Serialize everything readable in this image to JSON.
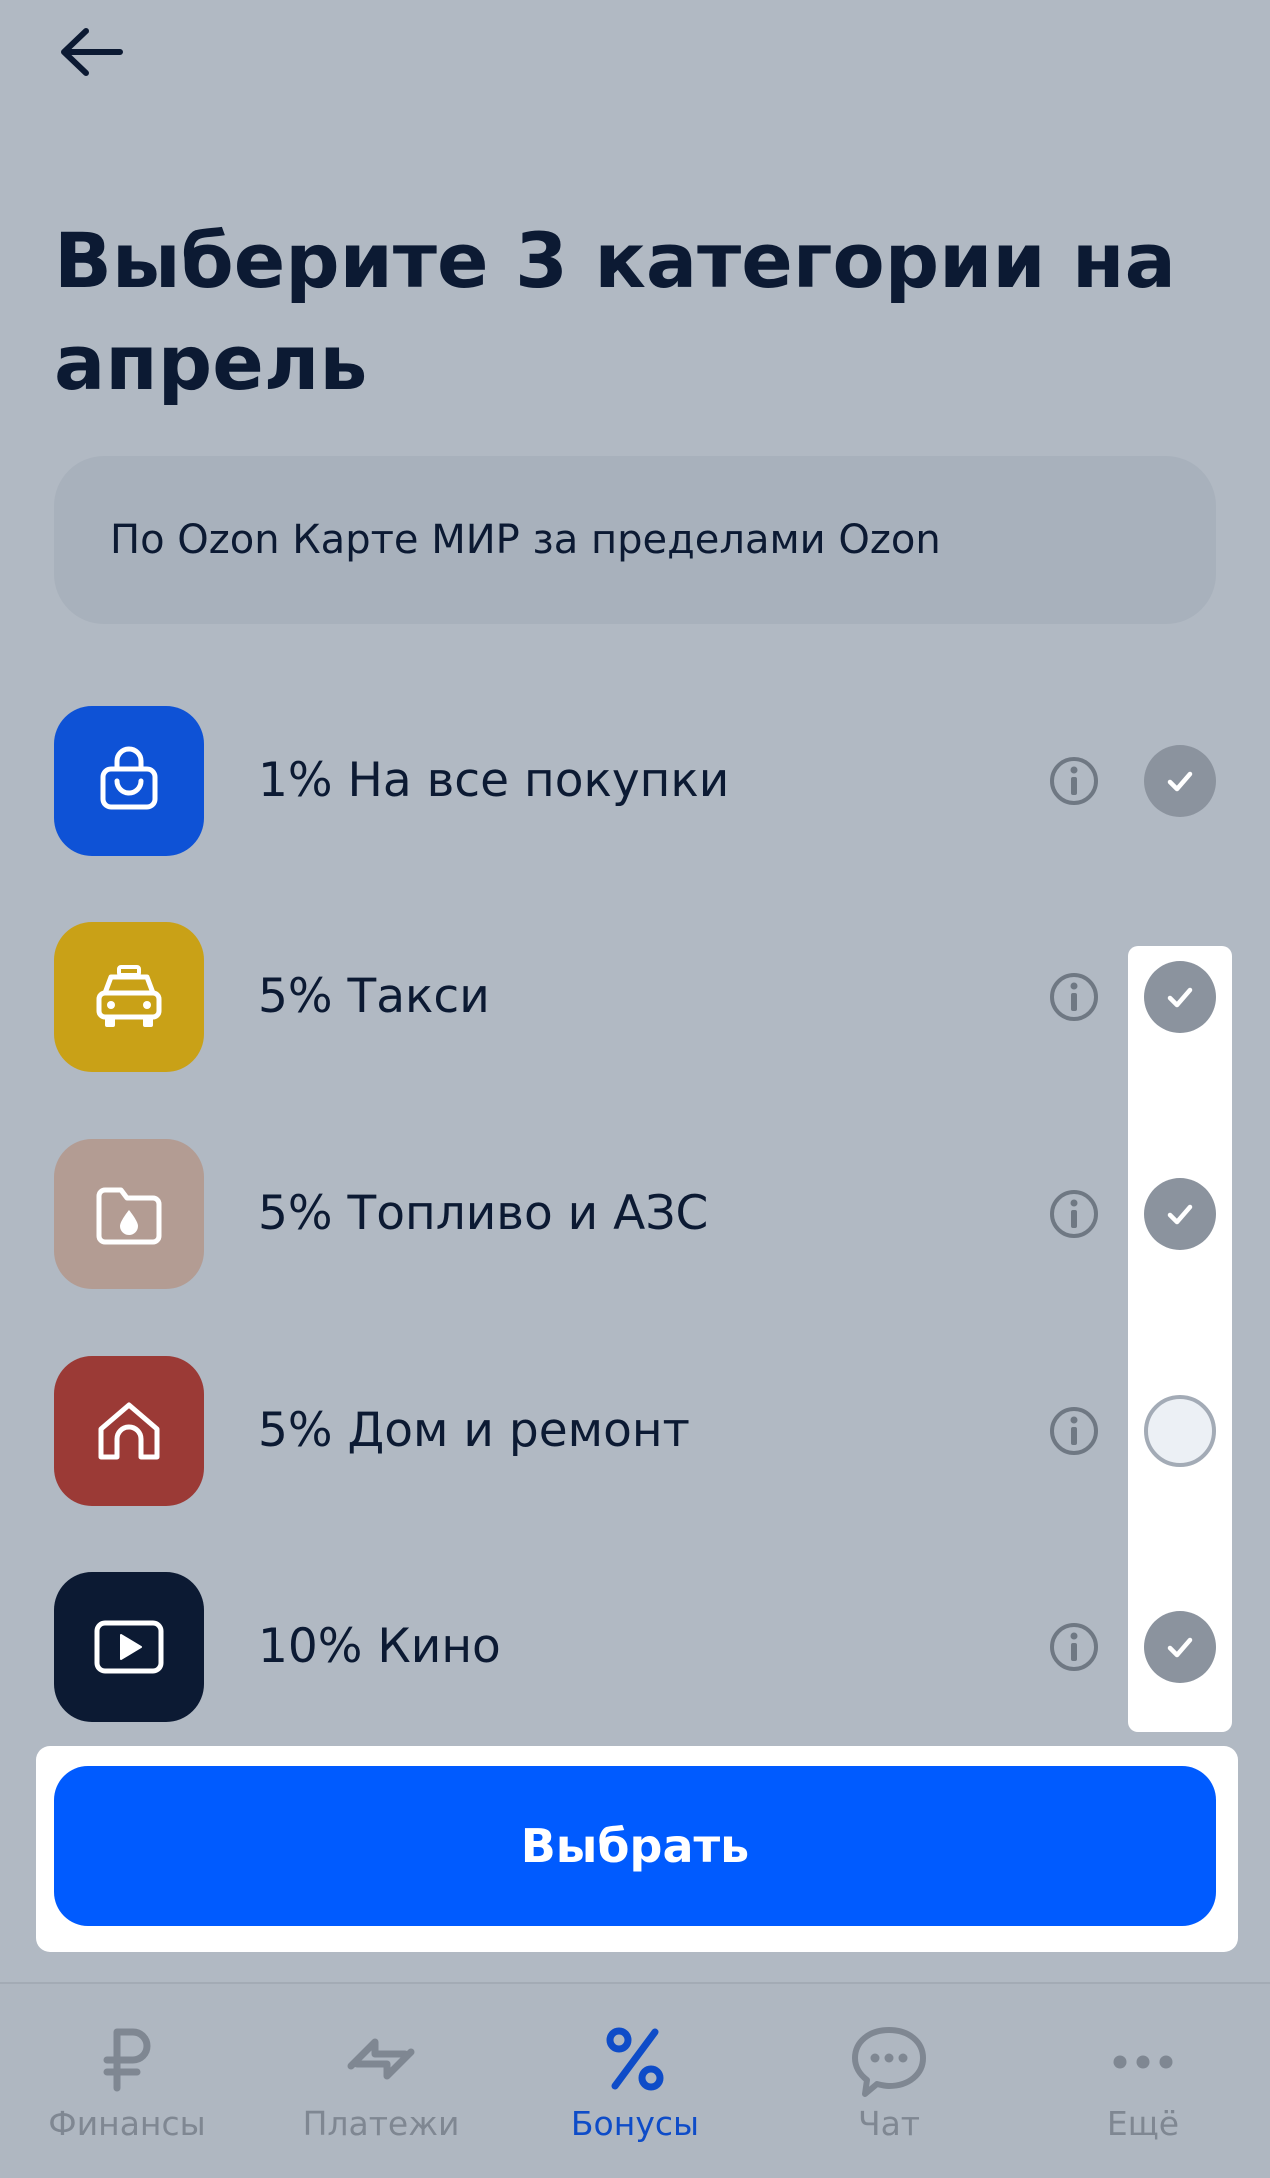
{
  "header": {
    "title": "Выберите 3 категории на апрель",
    "subtitle": "По Ozon Карте МИР за пределами Ozon"
  },
  "categories": [
    {
      "label": "1% На все покупки",
      "icon": "shopping-bag-icon",
      "color": "#0e52d6",
      "selected": true
    },
    {
      "label": "5% Такси",
      "icon": "taxi-icon",
      "color": "#c9a117",
      "selected": true
    },
    {
      "label": "5% Топливо и АЗС",
      "icon": "fuel-folder-icon",
      "color": "#b39c93",
      "selected": true
    },
    {
      "label": "5% Дом и ремонт",
      "icon": "home-icon",
      "color": "#9b3a36",
      "selected": false
    },
    {
      "label": "10% Кино",
      "icon": "play-icon",
      "color": "#0c1a33",
      "selected": true
    }
  ],
  "actions": {
    "select_label": "Выбрать"
  },
  "nav": {
    "items": [
      {
        "label": "Финансы",
        "icon": "ruble-icon",
        "active": false
      },
      {
        "label": "Платежи",
        "icon": "transfer-arrows-icon",
        "active": false
      },
      {
        "label": "Бонусы",
        "icon": "percent-icon",
        "active": true
      },
      {
        "label": "Чат",
        "icon": "chat-icon",
        "active": false
      },
      {
        "label": "Ещё",
        "icon": "more-dots-icon",
        "active": false
      }
    ]
  },
  "colors": {
    "accent": "#005bff",
    "active_nav": "#0e4cc8",
    "inactive_nav": "#7f8792"
  }
}
